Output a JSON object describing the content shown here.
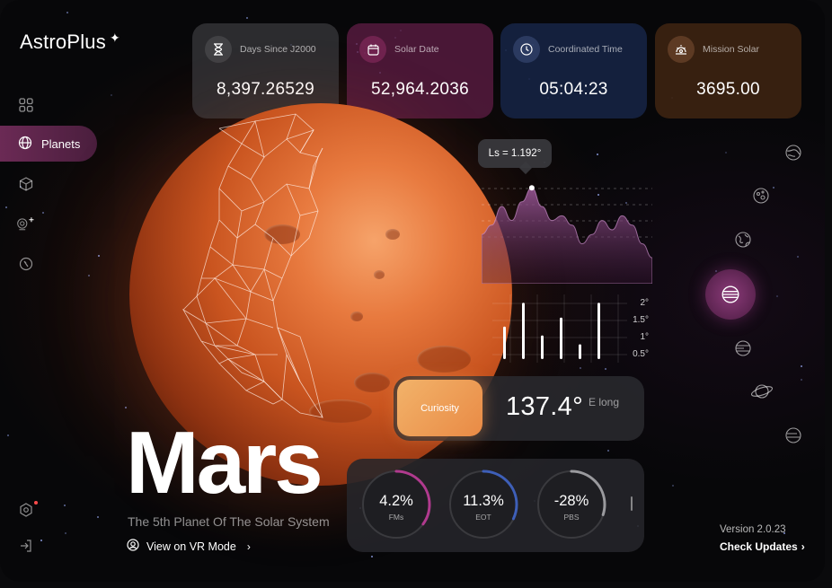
{
  "app": {
    "brand": "AstroPlus",
    "brand_mark": "✦"
  },
  "sidebar": {
    "items": [
      {
        "name": "dashboard",
        "icon": "grid-icon",
        "label": ""
      },
      {
        "name": "planets",
        "icon": "globe-icon",
        "label": "Planets",
        "active": true
      },
      {
        "name": "objects",
        "icon": "cube-icon",
        "label": ""
      },
      {
        "name": "observatory",
        "icon": "telescope-icon",
        "label": ""
      },
      {
        "name": "compass",
        "icon": "compass-icon",
        "label": ""
      }
    ],
    "bottom": [
      {
        "name": "settings",
        "icon": "gear-icon",
        "has_notification": true
      },
      {
        "name": "logout",
        "icon": "logout-icon"
      }
    ]
  },
  "stats": [
    {
      "label": "Days Since J2000",
      "value": "8,397.26529",
      "icon": "hourglass-icon",
      "color": "#343438"
    },
    {
      "label": "Solar Date",
      "value": "52,964.2036",
      "icon": "calendar-icon",
      "color": "#5c1c42"
    },
    {
      "label": "Coordinated Time",
      "value": "05:04:23",
      "icon": "clock-icon",
      "color": "#162446"
    },
    {
      "label": "Mission Solar",
      "value": "3695.00",
      "icon": "sun-cycle-icon",
      "color": "#402412"
    }
  ],
  "chart": {
    "tooltip": "Ls = 1.192°",
    "y_ticks": [
      "2°",
      "1.5°",
      "1°",
      "0.5°"
    ]
  },
  "chart_data": {
    "type": "area",
    "series": [
      {
        "values": [
          0.9,
          1.1,
          1.5,
          1.2,
          1.6,
          1.9,
          1.5,
          1.2,
          1.3,
          1.1,
          0.7,
          0.9,
          1.2,
          1.0,
          1.3,
          1.1,
          0.7,
          0.4
        ]
      }
    ],
    "bars": [
      1.1,
      1.9,
      0.8,
      1.4,
      0.5,
      1.9
    ],
    "ylim": [
      0,
      2
    ]
  },
  "rover": {
    "label": "Curiosity",
    "value": "137.4°",
    "unit": "E long"
  },
  "gauges": [
    {
      "value": "4.2%",
      "label": "FMs",
      "fraction": 0.35,
      "color": "#b03a8e"
    },
    {
      "value": "11.3%",
      "label": "EOT",
      "fraction": 0.32,
      "color": "#3e5fb8"
    },
    {
      "value": "-28%",
      "label": "PBS",
      "fraction": 0.3,
      "color": "#9a9a9e"
    }
  ],
  "planet": {
    "name": "Mars",
    "subtitle": "The 5th Planet Of The Solar System",
    "vr_link": "View on VR Mode"
  },
  "planet_selector": [
    "globe-icon",
    "moon-icon",
    "earth-icon",
    "jupiter-icon",
    "striped-planet-icon",
    "saturn-icon",
    "neptune-icon"
  ],
  "footer": {
    "version": "Version 2.0.23",
    "updates": "Check Updates"
  }
}
